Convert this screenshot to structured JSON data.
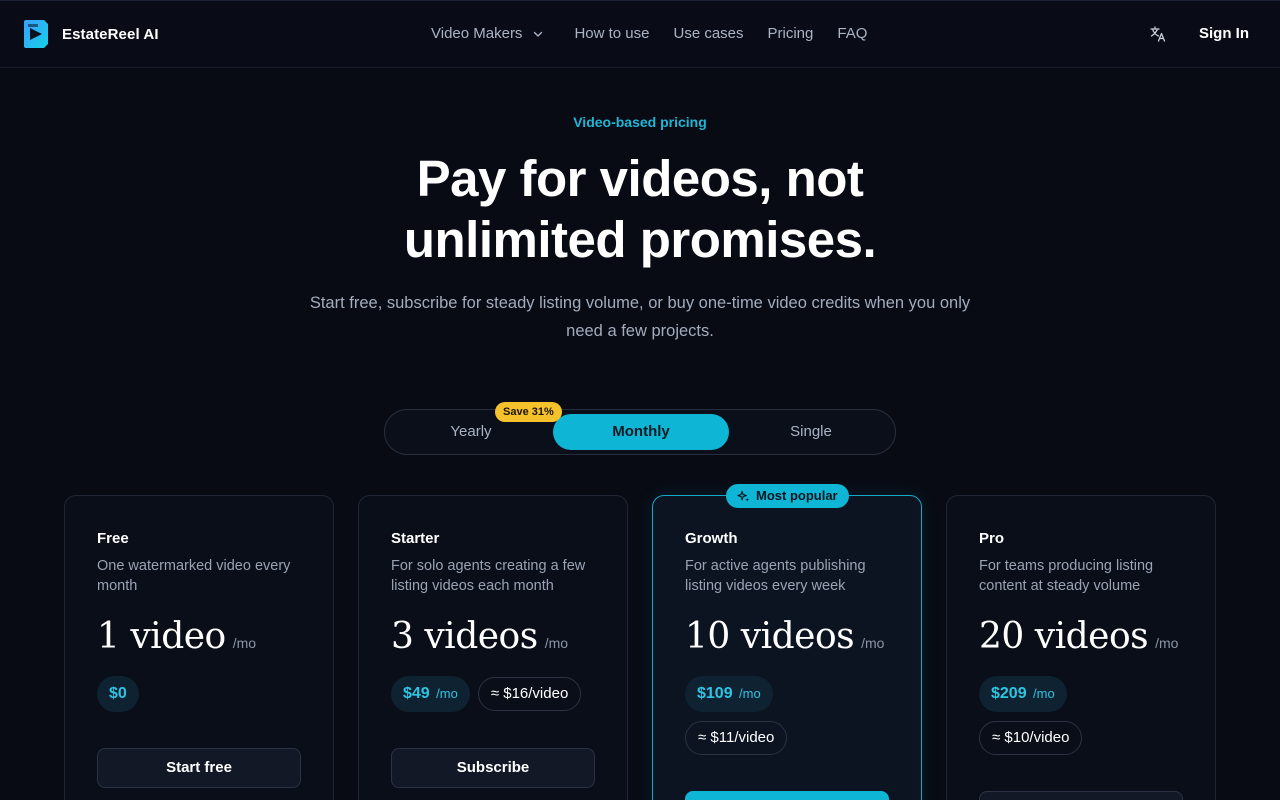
{
  "nav": {
    "brand": "EstateReel AI",
    "links": [
      "Video Makers",
      "How to use",
      "Use cases",
      "Pricing",
      "FAQ"
    ],
    "sign_in": "Sign In",
    "icons": {
      "logo": "estatereel-logo-icon",
      "language": "translate-icon",
      "menu": "chevron-down-icon"
    }
  },
  "hero": {
    "eyebrow": "Video-based pricing",
    "headline_line1": "Pay for videos, not",
    "headline_line2": "unlimited promises.",
    "subtitle": "Start free, subscribe for steady listing volume, or buy one-time video credits when you only need a few projects."
  },
  "billing": {
    "options": [
      "Yearly",
      "Monthly",
      "Single"
    ],
    "selected": "Monthly",
    "save_badge": "Save 31%"
  },
  "popular_badge": "Most popular",
  "plans": [
    {
      "name": "Free",
      "description": "One watermarked video every month",
      "quantity": "1 video",
      "per": "/mo",
      "price": "$0",
      "price_unit": "",
      "per_video": "",
      "cta": "Start free"
    },
    {
      "name": "Starter",
      "description": "For solo agents creating a few listing videos each month",
      "quantity": "3 videos",
      "per": "/mo",
      "price": "$49",
      "price_unit": "/mo",
      "per_video": "≈ $16/video",
      "cta": "Subscribe"
    },
    {
      "name": "Growth",
      "description": "For active agents publishing listing videos every week",
      "quantity": "10 videos",
      "per": "/mo",
      "price": "$109",
      "price_unit": "/mo",
      "per_video": "≈ $11/video",
      "cta": ""
    },
    {
      "name": "Pro",
      "description": "For teams producing listing content at steady volume",
      "quantity": "20 videos",
      "per": "/mo",
      "price": "$209",
      "price_unit": "/mo",
      "per_video": "≈ $10/video",
      "cta": ""
    }
  ],
  "colors": {
    "accent": "#0fb5d4",
    "badge": "#f6c22c",
    "background": "#080b14"
  }
}
